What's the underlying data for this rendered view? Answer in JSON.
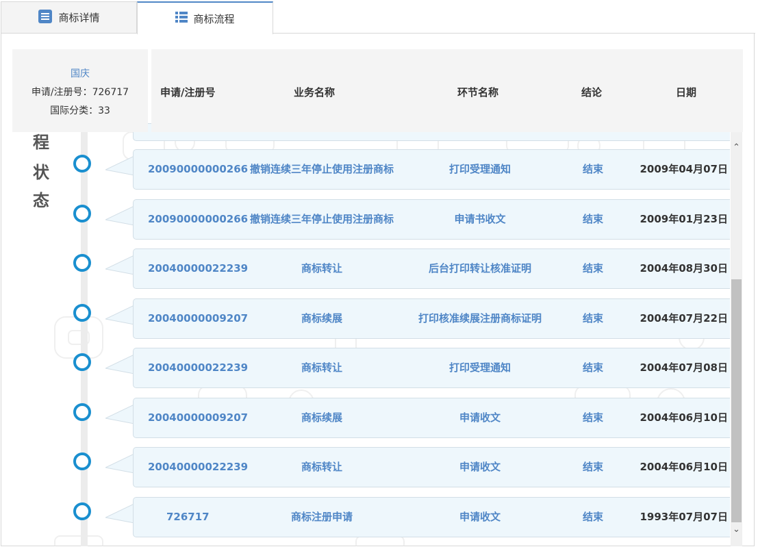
{
  "tabs": [
    {
      "label": "商标详情",
      "active": false
    },
    {
      "label": "商标流程",
      "active": true
    }
  ],
  "info": {
    "name": "国庆",
    "reg_line": "申请/注册号：726717",
    "class_line": "国际分类：33"
  },
  "side_title": [
    "程",
    "状",
    "态"
  ],
  "columns": [
    "申请/注册号",
    "业务名称",
    "环节名称",
    "结论",
    "日期"
  ],
  "rows": [
    {
      "no": "20090000000266",
      "biz": "撤销连续三年停止使用注册商标",
      "step": "打印受理通知",
      "result": "结束",
      "date": "2009年04月07日"
    },
    {
      "no": "20090000000266",
      "biz": "撤销连续三年停止使用注册商标",
      "step": "申请书收文",
      "result": "结束",
      "date": "2009年01月23日"
    },
    {
      "no": "20040000022239",
      "biz": "商标转让",
      "step": "后台打印转让核准证明",
      "result": "结束",
      "date": "2004年08月30日"
    },
    {
      "no": "20040000009207",
      "biz": "商标续展",
      "step": "打印核准续展注册商标证明",
      "result": "结束",
      "date": "2004年07月22日"
    },
    {
      "no": "20040000022239",
      "biz": "商标转让",
      "step": "打印受理通知",
      "result": "结束",
      "date": "2004年07月08日"
    },
    {
      "no": "20040000009207",
      "biz": "商标续展",
      "step": "申请收文",
      "result": "结束",
      "date": "2004年06月10日"
    },
    {
      "no": "20040000022239",
      "biz": "商标转让",
      "step": "申请收文",
      "result": "结束",
      "date": "2004年06月10日"
    },
    {
      "no": "726717",
      "biz": "商标注册申请",
      "step": "申请收文",
      "result": "结束",
      "date": "1993年07月07日"
    }
  ],
  "scroll_position": 0.55,
  "colors": {
    "accent": "#4f86c6",
    "node": "#1a8fcf",
    "row_bg": "#eef7fc",
    "header_bg": "#f4f4f4"
  },
  "icons": {
    "details_tab": "document-lines-icon",
    "flow_tab": "list-icon",
    "scroll_up": "chevron-up-icon",
    "scroll_down": "chevron-down-icon"
  }
}
